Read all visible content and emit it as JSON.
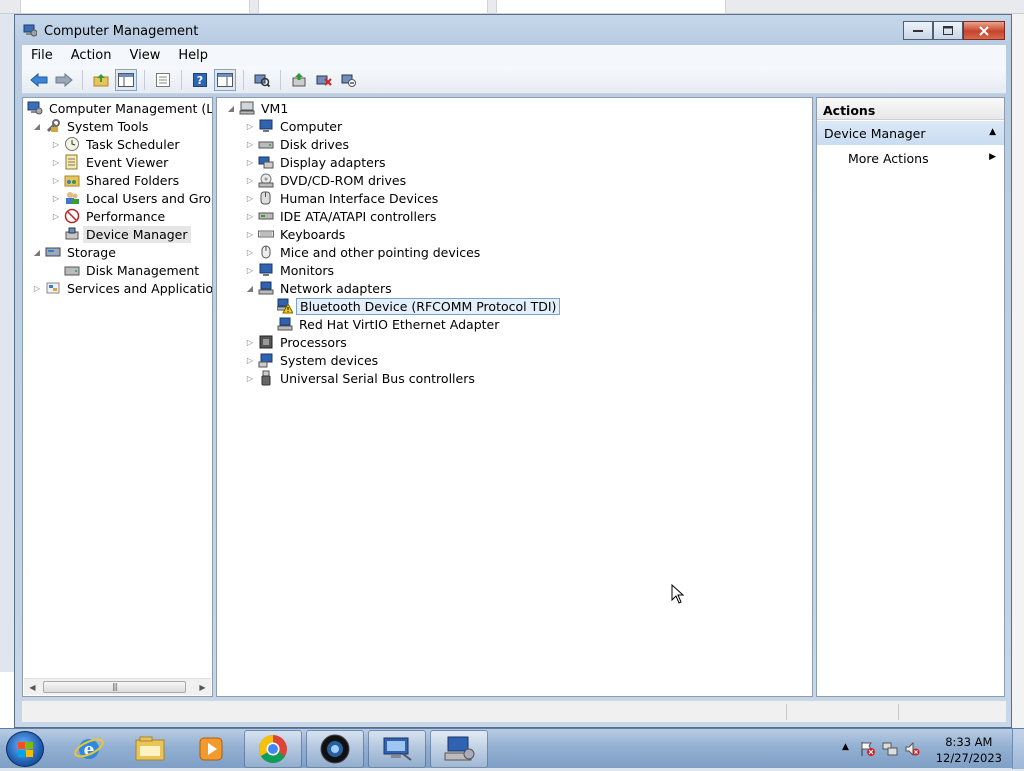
{
  "window": {
    "title": "Computer Management"
  },
  "menu": [
    "File",
    "Action",
    "View",
    "Help"
  ],
  "toolbar_icons": [
    "back-arrow-icon",
    "forward-arrow-icon",
    "up-folder-icon",
    "show-hide-tree-icon",
    "properties-icon",
    "help-icon",
    "show-hide-action-pane-icon",
    "scan-hardware-icon",
    "update-driver-icon",
    "uninstall-device-icon",
    "disable-device-icon"
  ],
  "left_tree": {
    "root": "Computer Management (Local",
    "system_tools": "System Tools",
    "task_scheduler": "Task Scheduler",
    "event_viewer": "Event Viewer",
    "shared_folders": "Shared Folders",
    "local_users": "Local Users and Groups",
    "performance": "Performance",
    "device_manager": "Device Manager",
    "storage": "Storage",
    "disk_management": "Disk Management",
    "services_apps": "Services and Applications"
  },
  "device_tree": {
    "root": "VM1",
    "categories": [
      "Computer",
      "Disk drives",
      "Display adapters",
      "DVD/CD-ROM drives",
      "Human Interface Devices",
      "IDE ATA/ATAPI controllers",
      "Keyboards",
      "Mice and other pointing devices",
      "Monitors",
      "Network adapters"
    ],
    "network_children": [
      "Bluetooth Device (RFCOMM Protocol TDI)",
      "Red Hat VirtIO Ethernet Adapter"
    ],
    "more_categories": [
      "Processors",
      "System devices",
      "Universal Serial Bus controllers"
    ]
  },
  "actions": {
    "header": "Actions",
    "section": "Device Manager",
    "more": "More Actions"
  },
  "taskbar": {
    "apps": [
      "internet-explorer",
      "file-explorer",
      "media-player",
      "chrome",
      "camera-app",
      "remote-desktop",
      "computer-management"
    ],
    "time": "8:33 AM",
    "date": "12/27/2023"
  },
  "colors": {
    "selection_blue": "#e3effb",
    "warning_yellow": "#f5d000",
    "accent": "#1f5fb0"
  }
}
